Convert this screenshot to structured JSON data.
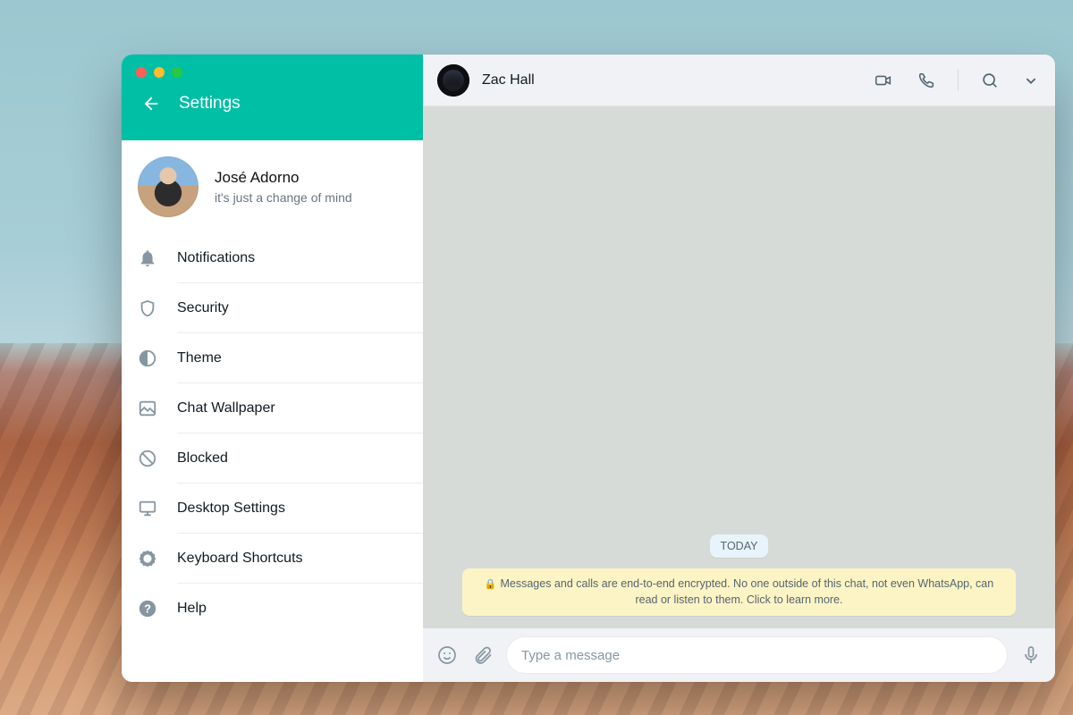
{
  "app": {
    "accent": "#00bfa5"
  },
  "sidebar": {
    "title": "Settings",
    "profile": {
      "name": "José Adorno",
      "status": "it's just a change of mind"
    },
    "items": [
      {
        "id": "notifications",
        "label": "Notifications",
        "icon": "bell"
      },
      {
        "id": "security",
        "label": "Security",
        "icon": "shield"
      },
      {
        "id": "theme",
        "label": "Theme",
        "icon": "theme"
      },
      {
        "id": "wallpaper",
        "label": "Chat Wallpaper",
        "icon": "image"
      },
      {
        "id": "blocked",
        "label": "Blocked",
        "icon": "blocked"
      },
      {
        "id": "desktop",
        "label": "Desktop Settings",
        "icon": "monitor"
      },
      {
        "id": "shortcuts",
        "label": "Keyboard Shortcuts",
        "icon": "gear-badge"
      },
      {
        "id": "help",
        "label": "Help",
        "icon": "help"
      }
    ]
  },
  "chat": {
    "header": {
      "name": "Zac Hall"
    },
    "date_label": "TODAY",
    "encryption_notice": "Messages and calls are end-to-end encrypted. No one outside of this chat, not even WhatsApp, can read or listen to them. Click to learn more.",
    "composer": {
      "placeholder": "Type a message"
    }
  }
}
